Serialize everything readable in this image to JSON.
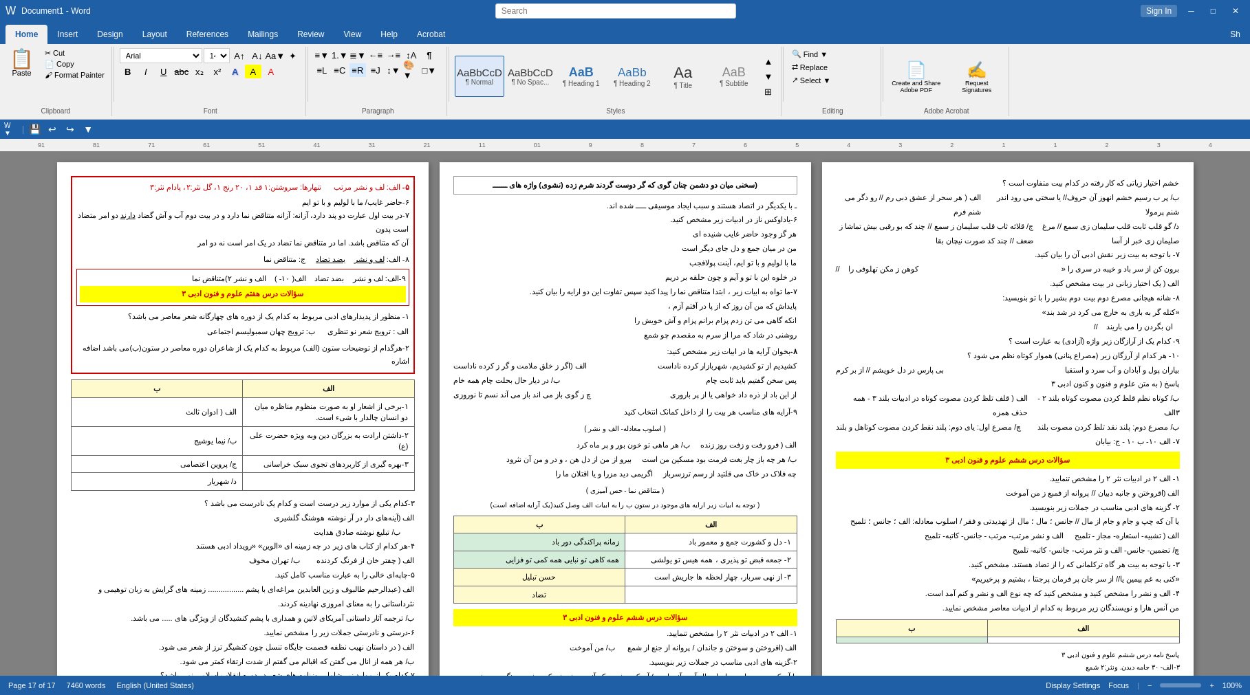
{
  "titlebar": {
    "app_name": "Word",
    "doc_title": "Document1 - Word",
    "search_placeholder": "Search",
    "sign_in": "Sign In",
    "minimize": "─",
    "maximize": "□",
    "close": "✕"
  },
  "tabs": [
    {
      "label": "Home",
      "active": true
    },
    {
      "label": "Insert",
      "active": false
    },
    {
      "label": "Design",
      "active": false
    },
    {
      "label": "Layout",
      "active": false
    },
    {
      "label": "References",
      "active": false
    },
    {
      "label": "Mailings",
      "active": false
    },
    {
      "label": "Review",
      "active": false
    },
    {
      "label": "View",
      "active": false
    },
    {
      "label": "Help",
      "active": false
    },
    {
      "label": "Acrobat",
      "active": false
    }
  ],
  "ribbon": {
    "clipboard": {
      "label": "Clipboard",
      "paste": "Paste",
      "cut": "Cut",
      "copy": "Copy",
      "format_painter": "Format Painter"
    },
    "font": {
      "label": "Font",
      "font_name": "Arial",
      "font_size": "14",
      "bold": "B",
      "italic": "I",
      "underline": "U",
      "strikethrough": "abc",
      "subscript": "x₂",
      "superscript": "x²"
    },
    "paragraph": {
      "label": "Paragraph"
    },
    "styles": {
      "label": "Styles",
      "items": [
        {
          "name": "Normal",
          "label": "¶ Normal"
        },
        {
          "name": "NoSpacing",
          "label": "¶ No Spac..."
        },
        {
          "name": "Heading1",
          "label": "¶ Heading 1"
        },
        {
          "name": "Heading2",
          "label": "¶ Heading 2"
        },
        {
          "name": "Title",
          "label": "¶ Title"
        },
        {
          "name": "Subtitle",
          "label": "¶ Subtitle"
        }
      ]
    },
    "editing": {
      "label": "Editing",
      "find": "Find",
      "replace": "Replace",
      "select": "Select"
    },
    "adobe": {
      "label": "Adobe Acrobat",
      "create_share": "Create and Share Adobe PDF",
      "request_sig": "Request Signatures"
    }
  },
  "quickaccess": {
    "save": "💾",
    "undo": "↩",
    "redo": "↪",
    "customize": "▼"
  },
  "ruler": {
    "marks": [
      "91",
      "81",
      "71",
      "61",
      "51",
      "41",
      "31",
      "21",
      "11",
      "01",
      "9",
      "8",
      "7",
      "6",
      "5",
      "4",
      "3",
      "2",
      "1",
      "1"
    ]
  },
  "statusbar": {
    "page_info": "Page 17 of 17",
    "words": "7460 words",
    "language": "English (United States)",
    "display_settings": "Display Settings",
    "zoom": "Focus",
    "zoom_level": "100%"
  },
  "pages": {
    "page1": {
      "title": "سؤالات درس هفتم علوم و فنون ادبی ۳",
      "highlight": true
    },
    "page2": {
      "title": "سخنی میان دو دشمن چنان گوی که گر دوست گردند شرم زده (نشوی) واژه های",
      "highlight": false
    },
    "page3": {
      "title": "",
      "highlight": false
    }
  }
}
